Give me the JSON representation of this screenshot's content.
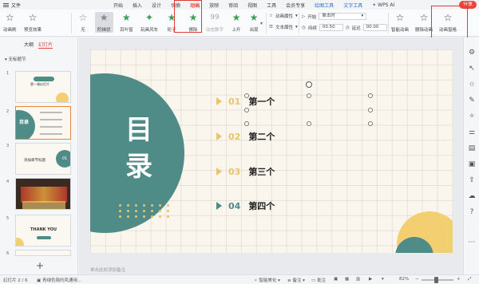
{
  "menubar": {
    "file": "文件",
    "tabs": [
      "开始",
      "插入",
      "设计",
      "切换",
      "动画",
      "放映",
      "审阅",
      "视图",
      "工具",
      "会员专享"
    ],
    "tool_tabs": [
      "绘图工具",
      "文字工具"
    ],
    "ai": "WPS AI",
    "share": "分享"
  },
  "ribbon": {
    "preview": "动画刷",
    "preview_effect": "预览效果",
    "anims": [
      "无",
      "阶梯状",
      "百叶窗",
      "玩具风车",
      "轮子",
      "擦除",
      "上升",
      "出现"
    ],
    "anim_digits": "99",
    "anim_digits_label": "动态数字",
    "anim_props": "动画属性",
    "text_props": "文本属性",
    "start_label": "开始",
    "start_value": "单击时",
    "duration_label": "持续",
    "duration_value": "00.50",
    "delay_label": "延迟",
    "delay_value": "00.00",
    "smart_anim": "智能动画",
    "delete_anim": "删除动画",
    "anim_pane": "动画窗格"
  },
  "leftpanel": {
    "tab_outline": "大纲",
    "tab_slides": "幻灯片",
    "title": "无标题节",
    "slides": [
      {
        "num": "1",
        "title": "第一课幻灯片"
      },
      {
        "num": "2",
        "title": "目录"
      },
      {
        "num": "3",
        "title": "添加章节标题",
        "badge": "01"
      },
      {
        "num": "4",
        "title": ""
      },
      {
        "num": "5",
        "title": "THANK YOU"
      },
      {
        "num": "6",
        "title": ""
      }
    ]
  },
  "slide": {
    "heading_char1": "目",
    "heading_char2": "录",
    "toc": [
      {
        "num": "01",
        "text": "第一个"
      },
      {
        "num": "02",
        "text": "第二个"
      },
      {
        "num": "03",
        "text": "第三个"
      },
      {
        "num": "04",
        "text": "第四个"
      }
    ]
  },
  "notes": "单击此处添加备注",
  "status": {
    "slide_pos": "幻灯片 2 / 6",
    "theme": "青绿色简约风通用...",
    "smart_beauty": "智能美化",
    "notes": "备注",
    "comment": "批注",
    "zoom": "82%"
  },
  "colors": {
    "teal": "#4f8b87",
    "yellow": "#e8c46a",
    "accent": "#e8463b"
  }
}
